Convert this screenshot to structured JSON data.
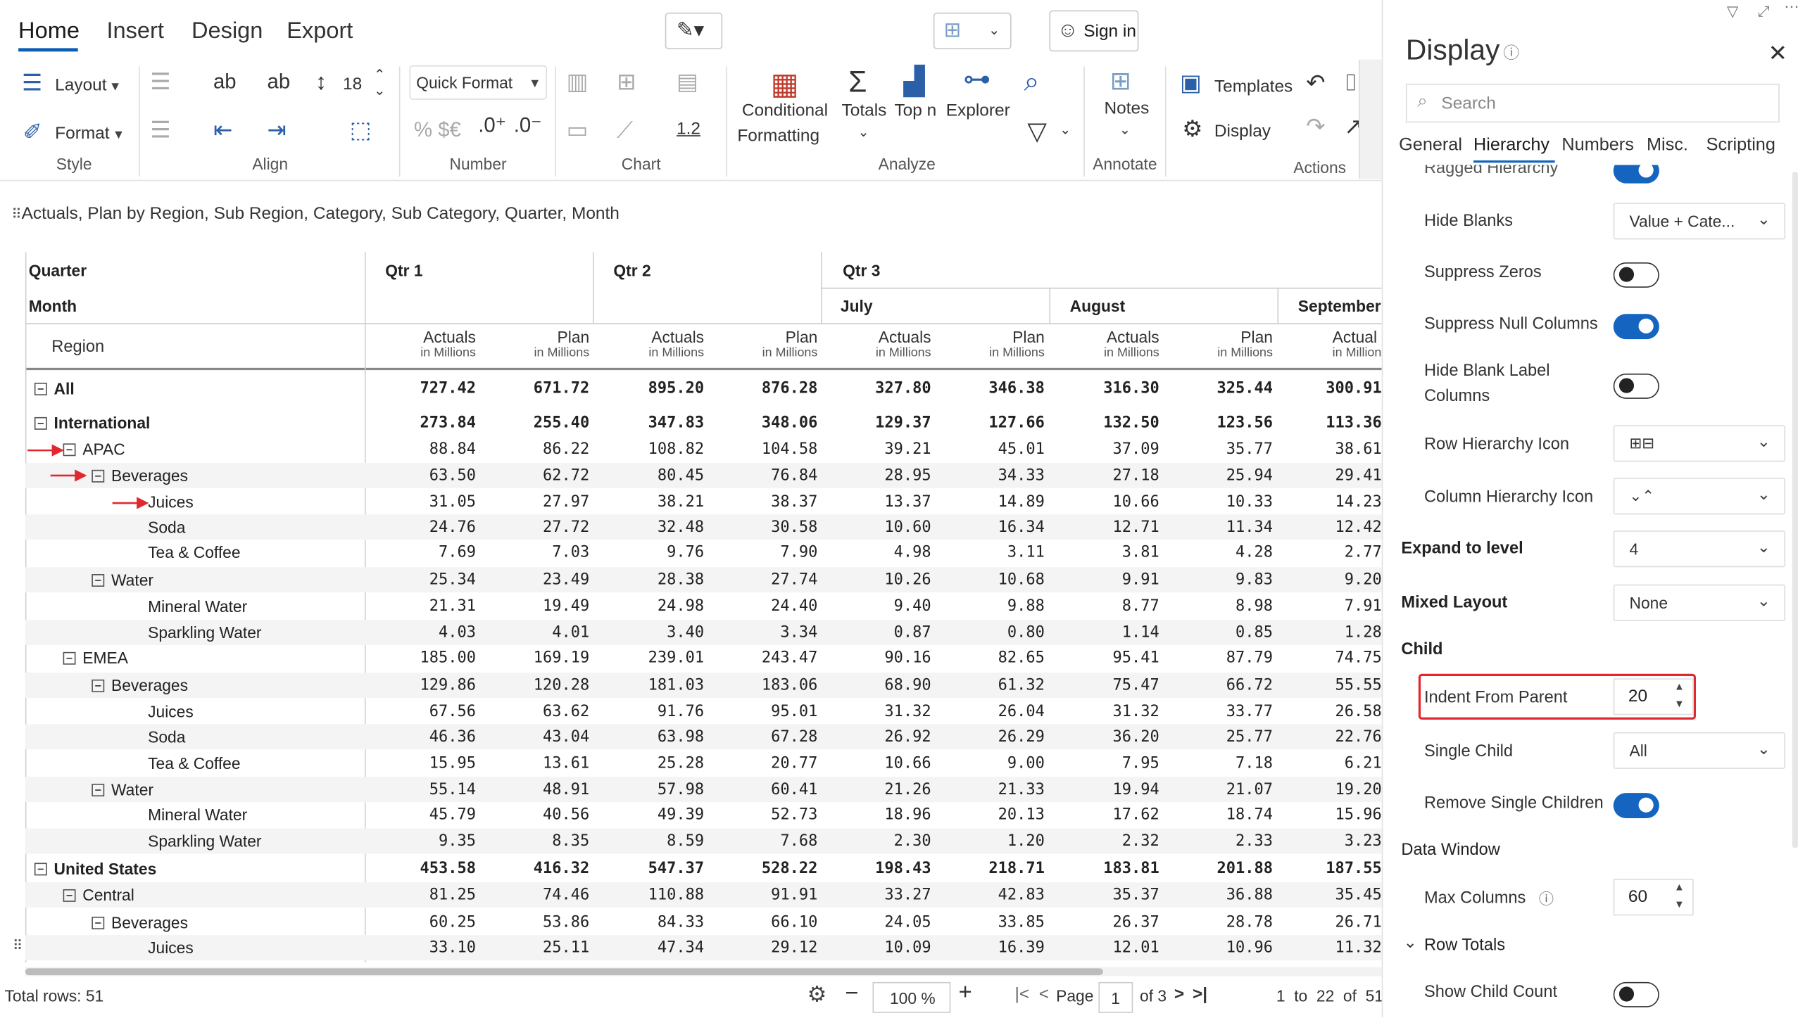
{
  "ribbon": {
    "tabs": [
      "Home",
      "Insert",
      "Design",
      "Export"
    ],
    "sign_in": "Sign in",
    "layout_label": "Layout",
    "format_label": "Format",
    "font_size": "18",
    "quick_format": "Quick Format",
    "decimal_label": "1.2",
    "conditional_formatting_1": "Conditional",
    "conditional_formatting_2": "Formatting",
    "totals": "Totals",
    "topn": "Top n",
    "explorer": "Explorer",
    "notes": "Notes",
    "templates": "Templates",
    "display": "Display",
    "groups": {
      "style": "Style",
      "align": "Align",
      "number": "Number",
      "chart": "Chart",
      "analyze": "Analyze",
      "annotate": "Annotate",
      "actions": "Actions"
    }
  },
  "breadcrumb": "Actuals, Plan by Region, Sub Region, Category, Sub Category, Quarter, Month",
  "table": {
    "quarter_label": "Quarter",
    "month_label": "Month",
    "region_label": "Region",
    "quarters": [
      "Qtr 1",
      "Qtr 2",
      "Qtr 3"
    ],
    "months": [
      "July",
      "August",
      "September"
    ],
    "measure_actuals": "Actuals",
    "measure_plan": "Plan",
    "measure_unit": "in Millions",
    "measure_partial": "Actual",
    "measure_unit_partial": "in Million",
    "rows": [
      {
        "label": "All",
        "level": 0,
        "bold": true,
        "toggle": true,
        "values": [
          "727.42",
          "671.72",
          "895.20",
          "876.28",
          "327.80",
          "346.38",
          "316.30",
          "325.44",
          "300.91"
        ]
      },
      {
        "label": "International",
        "level": 0,
        "bold": true,
        "toggle": true,
        "values": [
          "273.84",
          "255.40",
          "347.83",
          "348.06",
          "129.37",
          "127.66",
          "132.50",
          "123.56",
          "113.36"
        ]
      },
      {
        "label": "APAC",
        "level": 1,
        "bold": false,
        "toggle": true,
        "values": [
          "88.84",
          "86.22",
          "108.82",
          "104.58",
          "39.21",
          "45.01",
          "37.09",
          "35.77",
          "38.61"
        ]
      },
      {
        "label": "Beverages",
        "level": 2,
        "bold": false,
        "toggle": true,
        "values": [
          "63.50",
          "62.72",
          "80.45",
          "76.84",
          "28.95",
          "34.33",
          "27.18",
          "25.94",
          "29.41"
        ]
      },
      {
        "label": "Juices",
        "level": 3,
        "bold": false,
        "toggle": false,
        "values": [
          "31.05",
          "27.97",
          "38.21",
          "38.37",
          "13.37",
          "14.89",
          "10.66",
          "10.33",
          "14.23"
        ]
      },
      {
        "label": "Soda",
        "level": 3,
        "bold": false,
        "toggle": false,
        "values": [
          "24.76",
          "27.72",
          "32.48",
          "30.58",
          "10.60",
          "16.34",
          "12.71",
          "11.34",
          "12.42"
        ]
      },
      {
        "label": "Tea & Coffee",
        "level": 3,
        "bold": false,
        "toggle": false,
        "values": [
          "7.69",
          "7.03",
          "9.76",
          "7.90",
          "4.98",
          "3.11",
          "3.81",
          "4.28",
          "2.77"
        ]
      },
      {
        "label": "Water",
        "level": 2,
        "bold": false,
        "toggle": true,
        "values": [
          "25.34",
          "23.49",
          "28.38",
          "27.74",
          "10.26",
          "10.68",
          "9.91",
          "9.83",
          "9.20"
        ]
      },
      {
        "label": "Mineral Water",
        "level": 3,
        "bold": false,
        "toggle": false,
        "values": [
          "21.31",
          "19.49",
          "24.98",
          "24.40",
          "9.40",
          "9.88",
          "8.77",
          "8.98",
          "7.91"
        ]
      },
      {
        "label": "Sparkling Water",
        "level": 3,
        "bold": false,
        "toggle": false,
        "values": [
          "4.03",
          "4.01",
          "3.40",
          "3.34",
          "0.87",
          "0.80",
          "1.14",
          "0.85",
          "1.28"
        ]
      },
      {
        "label": "EMEA",
        "level": 1,
        "bold": false,
        "toggle": true,
        "values": [
          "185.00",
          "169.19",
          "239.01",
          "243.47",
          "90.16",
          "82.65",
          "95.41",
          "87.79",
          "74.75"
        ]
      },
      {
        "label": "Beverages",
        "level": 2,
        "bold": false,
        "toggle": true,
        "values": [
          "129.86",
          "120.28",
          "181.03",
          "183.06",
          "68.90",
          "61.32",
          "75.47",
          "66.72",
          "55.55"
        ]
      },
      {
        "label": "Juices",
        "level": 3,
        "bold": false,
        "toggle": false,
        "values": [
          "67.56",
          "63.62",
          "91.76",
          "95.01",
          "31.32",
          "26.04",
          "31.32",
          "33.77",
          "26.58"
        ]
      },
      {
        "label": "Soda",
        "level": 3,
        "bold": false,
        "toggle": false,
        "values": [
          "46.36",
          "43.04",
          "63.98",
          "67.28",
          "26.92",
          "26.29",
          "36.20",
          "25.77",
          "22.76"
        ]
      },
      {
        "label": "Tea & Coffee",
        "level": 3,
        "bold": false,
        "toggle": false,
        "values": [
          "15.95",
          "13.61",
          "25.28",
          "20.77",
          "10.66",
          "9.00",
          "7.95",
          "7.18",
          "6.21"
        ]
      },
      {
        "label": "Water",
        "level": 2,
        "bold": false,
        "toggle": true,
        "values": [
          "55.14",
          "48.91",
          "57.98",
          "60.41",
          "21.26",
          "21.33",
          "19.94",
          "21.07",
          "19.20"
        ]
      },
      {
        "label": "Mineral Water",
        "level": 3,
        "bold": false,
        "toggle": false,
        "values": [
          "45.79",
          "40.56",
          "49.39",
          "52.73",
          "18.96",
          "20.13",
          "17.62",
          "18.74",
          "15.96"
        ]
      },
      {
        "label": "Sparkling Water",
        "level": 3,
        "bold": false,
        "toggle": false,
        "values": [
          "9.35",
          "8.35",
          "8.59",
          "7.68",
          "2.30",
          "1.20",
          "2.32",
          "2.33",
          "3.23"
        ]
      },
      {
        "label": "United States",
        "level": 0,
        "bold": true,
        "toggle": true,
        "values": [
          "453.58",
          "416.32",
          "547.37",
          "528.22",
          "198.43",
          "218.71",
          "183.81",
          "201.88",
          "187.55"
        ]
      },
      {
        "label": "Central",
        "level": 1,
        "bold": false,
        "toggle": true,
        "values": [
          "81.25",
          "74.46",
          "110.88",
          "91.91",
          "33.27",
          "42.83",
          "35.37",
          "36.88",
          "35.45"
        ]
      },
      {
        "label": "Beverages",
        "level": 2,
        "bold": false,
        "toggle": true,
        "values": [
          "60.25",
          "53.86",
          "84.33",
          "66.10",
          "24.05",
          "33.85",
          "26.37",
          "28.78",
          "26.71"
        ]
      },
      {
        "label": "Juices",
        "level": 3,
        "bold": false,
        "toggle": false,
        "values": [
          "33.10",
          "25.11",
          "47.34",
          "29.12",
          "10.09",
          "16.39",
          "12.01",
          "10.96",
          "11.32"
        ]
      }
    ]
  },
  "footer": {
    "total_rows": "Total rows: 51",
    "zoom": "100 %",
    "page_label": "Page",
    "page_number": "1",
    "page_of": "of 3",
    "range": "1  to  22  of  51"
  },
  "panel": {
    "title": "Display",
    "search_placeholder": "Search",
    "tabs": [
      "General",
      "Hierarchy",
      "Numbers",
      "Misc.",
      "Scripting"
    ],
    "ragged_hierarchy": "Ragged Hierarchy",
    "hide_blanks": "Hide Blanks",
    "hide_blanks_value": "Value + Cate...",
    "suppress_zeros": "Suppress Zeros",
    "suppress_null_columns": "Suppress Null Columns",
    "hide_blank_label_1": "Hide Blank Label",
    "hide_blank_label_2": "Columns",
    "row_hierarchy_icon": "Row Hierarchy Icon",
    "column_hierarchy_icon": "Column Hierarchy Icon",
    "expand_to_level": "Expand to level",
    "expand_to_level_value": "4",
    "mixed_layout": "Mixed Layout",
    "mixed_layout_value": "None",
    "child_section": "Child",
    "indent_from_parent": "Indent From Parent",
    "indent_from_parent_value": "20",
    "single_child": "Single Child",
    "single_child_value": "All",
    "remove_single_children": "Remove Single Children",
    "data_window": "Data Window",
    "max_columns": "Max Columns",
    "max_columns_value": "60",
    "row_totals": "Row Totals",
    "show_child_count": "Show Child Count"
  },
  "colors": {
    "accent": "#1565c0",
    "highlight_box": "#e0282e",
    "arrow": "#e0282e",
    "row_alt": "#f4f4f4"
  }
}
